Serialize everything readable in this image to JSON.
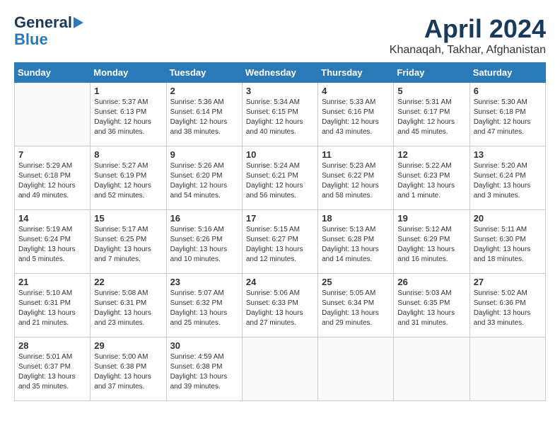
{
  "header": {
    "logo_line1": "General",
    "logo_line2": "Blue",
    "title": "April 2024",
    "subtitle": "Khanaqah, Takhar, Afghanistan"
  },
  "calendar": {
    "days_of_week": [
      "Sunday",
      "Monday",
      "Tuesday",
      "Wednesday",
      "Thursday",
      "Friday",
      "Saturday"
    ],
    "weeks": [
      [
        {
          "day": "",
          "info": ""
        },
        {
          "day": "1",
          "info": "Sunrise: 5:37 AM\nSunset: 6:13 PM\nDaylight: 12 hours\nand 36 minutes."
        },
        {
          "day": "2",
          "info": "Sunrise: 5:36 AM\nSunset: 6:14 PM\nDaylight: 12 hours\nand 38 minutes."
        },
        {
          "day": "3",
          "info": "Sunrise: 5:34 AM\nSunset: 6:15 PM\nDaylight: 12 hours\nand 40 minutes."
        },
        {
          "day": "4",
          "info": "Sunrise: 5:33 AM\nSunset: 6:16 PM\nDaylight: 12 hours\nand 43 minutes."
        },
        {
          "day": "5",
          "info": "Sunrise: 5:31 AM\nSunset: 6:17 PM\nDaylight: 12 hours\nand 45 minutes."
        },
        {
          "day": "6",
          "info": "Sunrise: 5:30 AM\nSunset: 6:18 PM\nDaylight: 12 hours\nand 47 minutes."
        }
      ],
      [
        {
          "day": "7",
          "info": "Sunrise: 5:29 AM\nSunset: 6:18 PM\nDaylight: 12 hours\nand 49 minutes."
        },
        {
          "day": "8",
          "info": "Sunrise: 5:27 AM\nSunset: 6:19 PM\nDaylight: 12 hours\nand 52 minutes."
        },
        {
          "day": "9",
          "info": "Sunrise: 5:26 AM\nSunset: 6:20 PM\nDaylight: 12 hours\nand 54 minutes."
        },
        {
          "day": "10",
          "info": "Sunrise: 5:24 AM\nSunset: 6:21 PM\nDaylight: 12 hours\nand 56 minutes."
        },
        {
          "day": "11",
          "info": "Sunrise: 5:23 AM\nSunset: 6:22 PM\nDaylight: 12 hours\nand 58 minutes."
        },
        {
          "day": "12",
          "info": "Sunrise: 5:22 AM\nSunset: 6:23 PM\nDaylight: 13 hours\nand 1 minute."
        },
        {
          "day": "13",
          "info": "Sunrise: 5:20 AM\nSunset: 6:24 PM\nDaylight: 13 hours\nand 3 minutes."
        }
      ],
      [
        {
          "day": "14",
          "info": "Sunrise: 5:19 AM\nSunset: 6:24 PM\nDaylight: 13 hours\nand 5 minutes."
        },
        {
          "day": "15",
          "info": "Sunrise: 5:17 AM\nSunset: 6:25 PM\nDaylight: 13 hours\nand 7 minutes."
        },
        {
          "day": "16",
          "info": "Sunrise: 5:16 AM\nSunset: 6:26 PM\nDaylight: 13 hours\nand 10 minutes."
        },
        {
          "day": "17",
          "info": "Sunrise: 5:15 AM\nSunset: 6:27 PM\nDaylight: 13 hours\nand 12 minutes."
        },
        {
          "day": "18",
          "info": "Sunrise: 5:13 AM\nSunset: 6:28 PM\nDaylight: 13 hours\nand 14 minutes."
        },
        {
          "day": "19",
          "info": "Sunrise: 5:12 AM\nSunset: 6:29 PM\nDaylight: 13 hours\nand 16 minutes."
        },
        {
          "day": "20",
          "info": "Sunrise: 5:11 AM\nSunset: 6:30 PM\nDaylight: 13 hours\nand 18 minutes."
        }
      ],
      [
        {
          "day": "21",
          "info": "Sunrise: 5:10 AM\nSunset: 6:31 PM\nDaylight: 13 hours\nand 21 minutes."
        },
        {
          "day": "22",
          "info": "Sunrise: 5:08 AM\nSunset: 6:31 PM\nDaylight: 13 hours\nand 23 minutes."
        },
        {
          "day": "23",
          "info": "Sunrise: 5:07 AM\nSunset: 6:32 PM\nDaylight: 13 hours\nand 25 minutes."
        },
        {
          "day": "24",
          "info": "Sunrise: 5:06 AM\nSunset: 6:33 PM\nDaylight: 13 hours\nand 27 minutes."
        },
        {
          "day": "25",
          "info": "Sunrise: 5:05 AM\nSunset: 6:34 PM\nDaylight: 13 hours\nand 29 minutes."
        },
        {
          "day": "26",
          "info": "Sunrise: 5:03 AM\nSunset: 6:35 PM\nDaylight: 13 hours\nand 31 minutes."
        },
        {
          "day": "27",
          "info": "Sunrise: 5:02 AM\nSunset: 6:36 PM\nDaylight: 13 hours\nand 33 minutes."
        }
      ],
      [
        {
          "day": "28",
          "info": "Sunrise: 5:01 AM\nSunset: 6:37 PM\nDaylight: 13 hours\nand 35 minutes."
        },
        {
          "day": "29",
          "info": "Sunrise: 5:00 AM\nSunset: 6:38 PM\nDaylight: 13 hours\nand 37 minutes."
        },
        {
          "day": "30",
          "info": "Sunrise: 4:59 AM\nSunset: 6:38 PM\nDaylight: 13 hours\nand 39 minutes."
        },
        {
          "day": "",
          "info": ""
        },
        {
          "day": "",
          "info": ""
        },
        {
          "day": "",
          "info": ""
        },
        {
          "day": "",
          "info": ""
        }
      ]
    ]
  }
}
